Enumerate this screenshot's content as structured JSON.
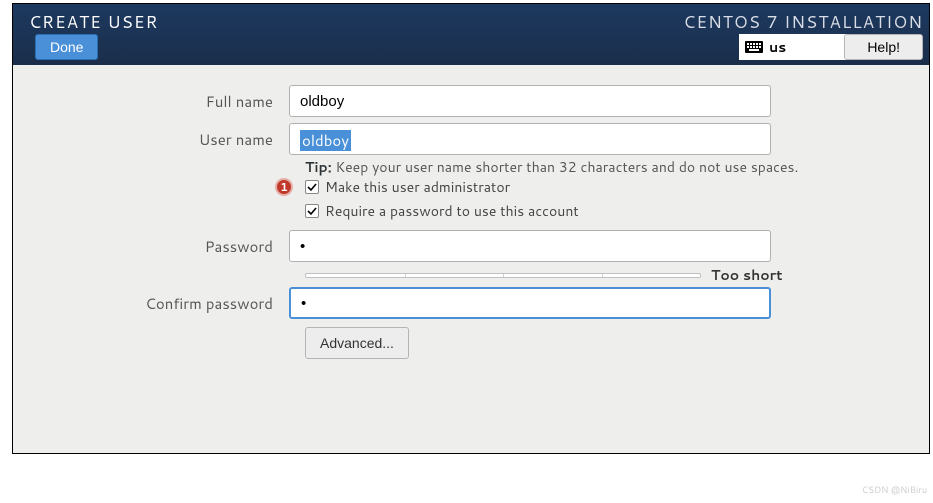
{
  "header": {
    "title": "CREATE USER",
    "installer_title": "CENTOS 7 INSTALLATION",
    "done_label": "Done",
    "help_label": "Help!",
    "keyboard": "us"
  },
  "form": {
    "full_name_label": "Full name",
    "full_name_value": "oldboy",
    "user_name_label": "User name",
    "user_name_value": "oldboy",
    "tip_prefix": "Tip:",
    "tip_text": " Keep your user name shorter than 32 characters and do not use spaces.",
    "admin_checkbox_label": "Make this user administrator",
    "admin_checked": true,
    "password_required_label": "Require a password to use this account",
    "password_required_checked": true,
    "password_label": "Password",
    "password_value": "•",
    "strength_text": "Too short",
    "confirm_label": "Confirm password",
    "confirm_value": "•",
    "advanced_label": "Advanced..."
  },
  "annotation": {
    "badge1": "1"
  },
  "watermark": "CSDN @NiBiru"
}
